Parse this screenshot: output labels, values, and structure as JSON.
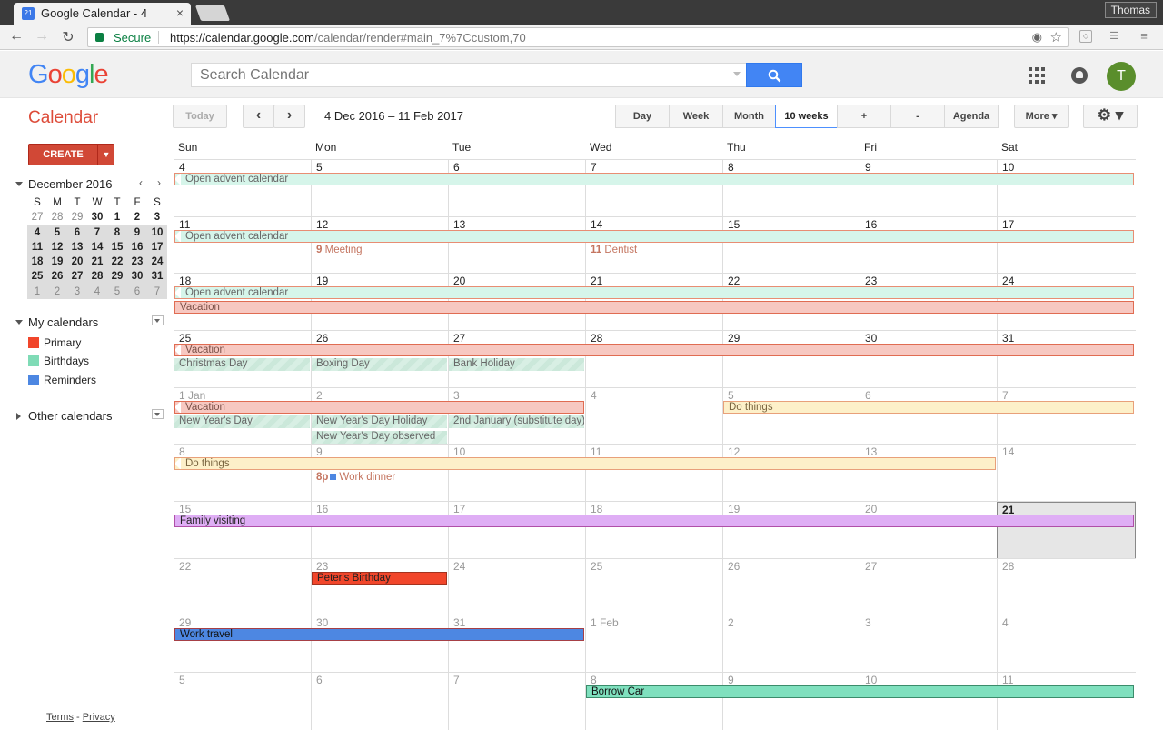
{
  "browser": {
    "tab_title": "Google Calendar - 4",
    "tab_favicon": "21",
    "user": "Thomas",
    "secure_label": "Secure",
    "url_host": "https://calendar.google.com",
    "url_path": "/calendar/render#main_7%7Ccustom,70"
  },
  "header": {
    "logo": "Google",
    "search_placeholder": "Search Calendar",
    "avatar_letter": "T"
  },
  "toolbar": {
    "app_title": "Calendar",
    "today_label": "Today",
    "prev": "‹",
    "next": "›",
    "date_range": "4 Dec 2016 – 11 Feb 2017",
    "views": [
      "Day",
      "Week",
      "Month",
      "10 weeks",
      "+",
      "-",
      "Agenda"
    ],
    "active_view": "10 weeks",
    "more_label": "More ▾",
    "settings": "⚙ ▾"
  },
  "sidebar": {
    "create_label": "CREATE",
    "create_dropdown": "▼",
    "mini_month": "December 2016",
    "mini_prev": "‹",
    "mini_next": "›",
    "mini_dow": [
      "S",
      "M",
      "T",
      "W",
      "T",
      "F",
      "S"
    ],
    "mini_weeks": [
      [
        "27",
        "28",
        "29",
        "30",
        "1",
        "2",
        "3"
      ],
      [
        "4",
        "5",
        "6",
        "7",
        "8",
        "9",
        "10"
      ],
      [
        "11",
        "12",
        "13",
        "14",
        "15",
        "16",
        "17"
      ],
      [
        "18",
        "19",
        "20",
        "21",
        "22",
        "23",
        "24"
      ],
      [
        "25",
        "26",
        "27",
        "28",
        "29",
        "30",
        "31"
      ],
      [
        "1",
        "2",
        "3",
        "4",
        "5",
        "6",
        "7"
      ]
    ],
    "my_calendars_label": "My calendars",
    "my_calendars": [
      {
        "name": "Primary",
        "color": "#f1462b"
      },
      {
        "name": "Birthdays",
        "color": "#7fdbb6"
      },
      {
        "name": "Reminders",
        "color": "#4d87e2"
      }
    ],
    "other_calendars_label": "Other calendars",
    "footer_terms": "Terms",
    "footer_sep": " - ",
    "footer_privacy": "Privacy"
  },
  "calendar": {
    "dow": [
      "Sun",
      "Mon",
      "Tue",
      "Wed",
      "Thu",
      "Fri",
      "Sat"
    ],
    "weeks": [
      [
        "4",
        "5",
        "6",
        "7",
        "8",
        "9",
        "10"
      ],
      [
        "11",
        "12",
        "13",
        "14",
        "15",
        "16",
        "17"
      ],
      [
        "18",
        "19",
        "20",
        "21",
        "22",
        "23",
        "24"
      ],
      [
        "25",
        "26",
        "27",
        "28",
        "29",
        "30",
        "31"
      ],
      [
        "1 Jan",
        "2",
        "3",
        "4",
        "5",
        "6",
        "7"
      ],
      [
        "8",
        "9",
        "10",
        "11",
        "12",
        "13",
        "14"
      ],
      [
        "15",
        "16",
        "17",
        "18",
        "19",
        "20",
        "21"
      ],
      [
        "22",
        "23",
        "24",
        "25",
        "26",
        "27",
        "28"
      ],
      [
        "29",
        "30",
        "31",
        "1 Feb",
        "2",
        "3",
        "4"
      ],
      [
        "5",
        "6",
        "7",
        "8",
        "9",
        "10",
        "11"
      ]
    ],
    "events": {
      "advent": "Open advent calendar",
      "meeting_time": "9",
      "meeting": "Meeting",
      "dentist_time": "11",
      "dentist": "Dentist",
      "vacation": "Vacation",
      "christmas": "Christmas Day",
      "boxing": "Boxing Day",
      "bank": "Bank Holiday",
      "do_things": "Do things",
      "new_year": "New Year's Day",
      "new_year_holiday": "New Year's Day Holiday",
      "new_year_observed": "New Year's Day observed",
      "second_jan": "2nd January (substitute day)",
      "dinner_time": "8p",
      "work_dinner": "Work dinner",
      "family": "Family visiting",
      "birthday": "Peter's Birthday",
      "travel": "Work travel",
      "borrow_car": "Borrow Car"
    }
  }
}
